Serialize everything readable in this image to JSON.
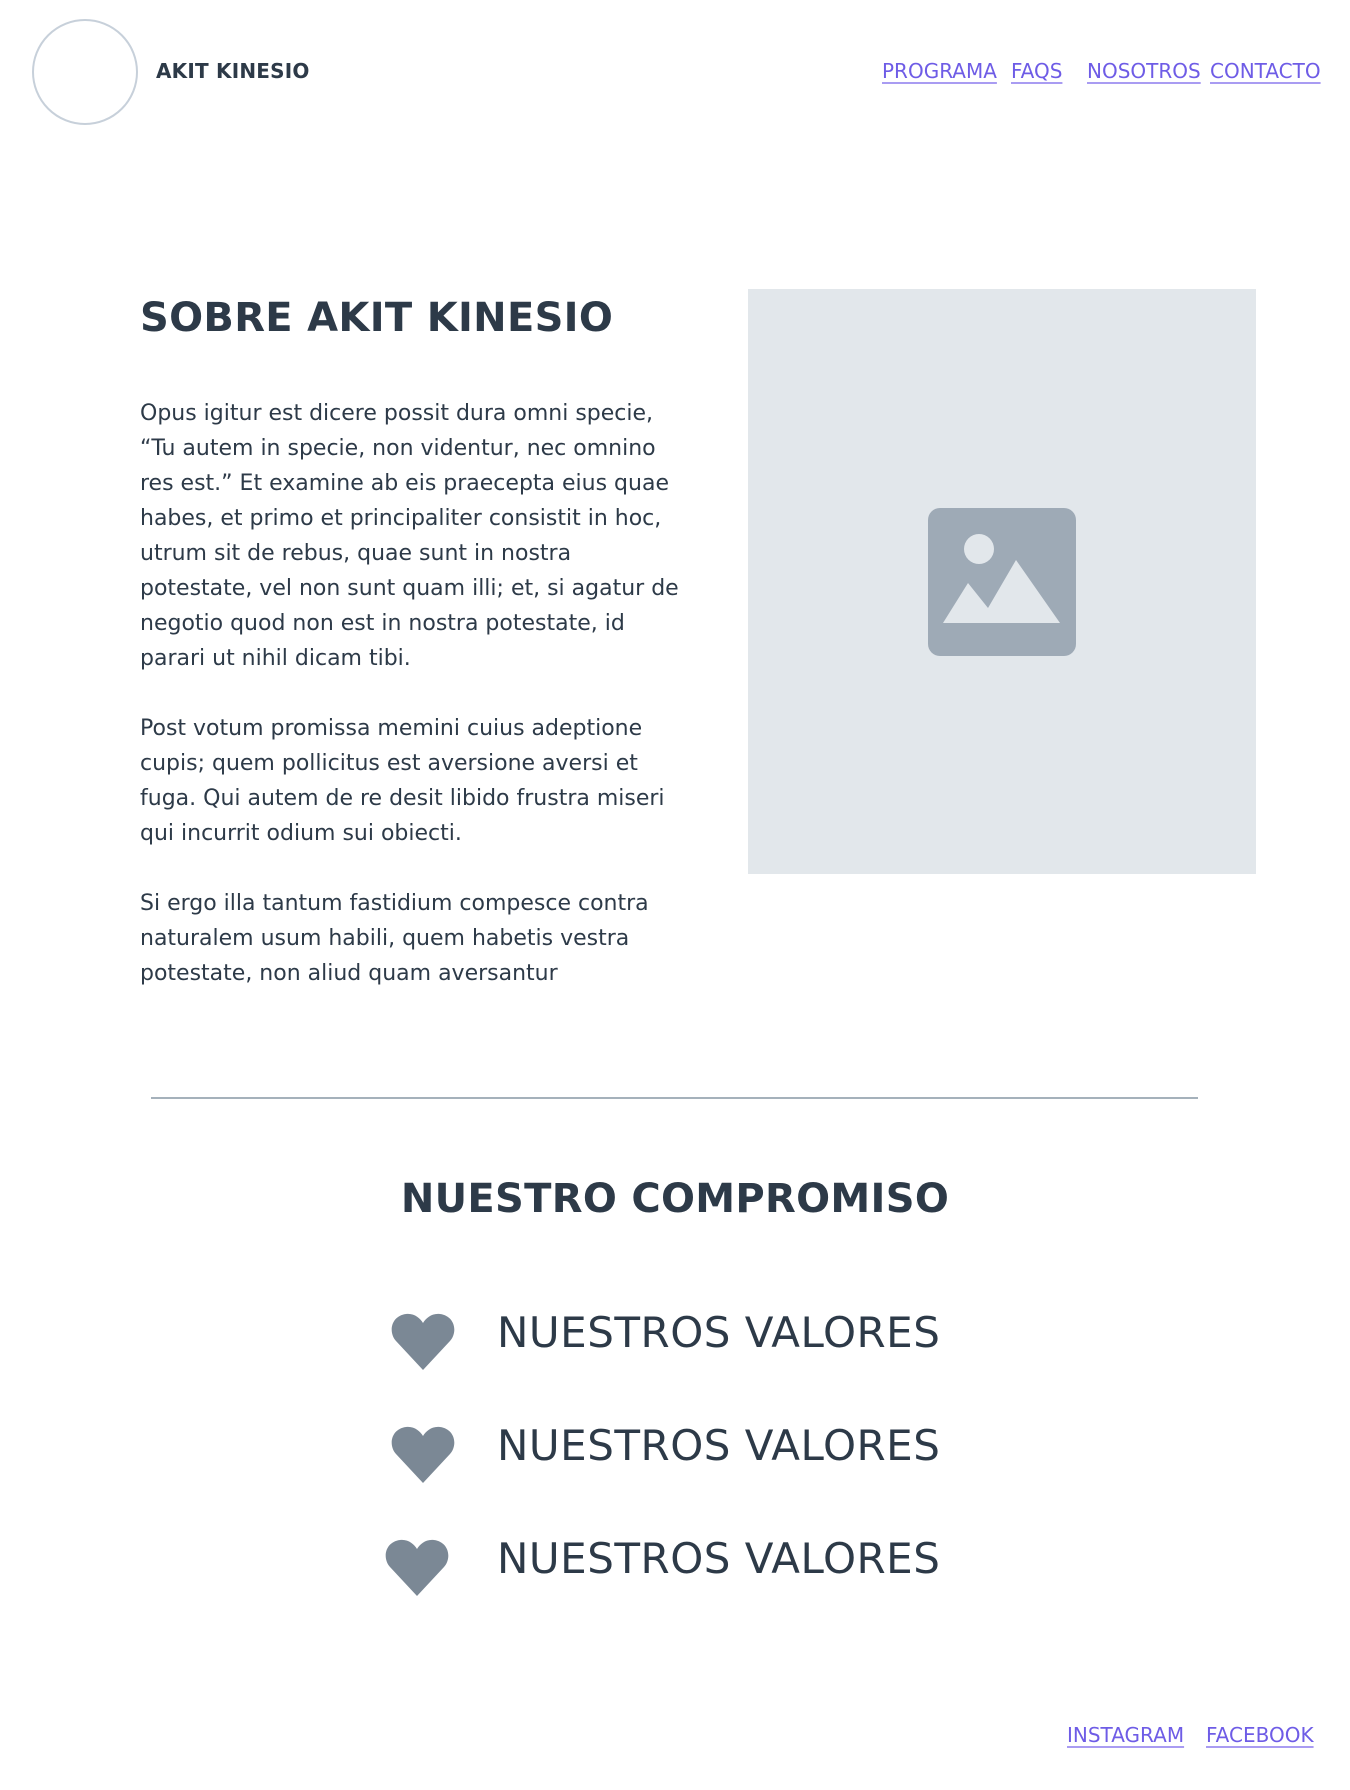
{
  "header": {
    "brand": "AKIT KINESIO",
    "nav": [
      {
        "label": "PROGRAMA"
      },
      {
        "label": "FAQS"
      },
      {
        "label": "NOSOTROS"
      },
      {
        "label": "CONTACTO"
      }
    ]
  },
  "about": {
    "title": "SOBRE AKIT KINESIO",
    "paragraphs": [
      "Opus igitur est dicere possit dura omni specie, “Tu autem in specie, non videntur, nec omnino res est.” Et examine ab eis praecepta eius quae habes, et primo et principaliter consistit in hoc, utrum sit de rebus, quae sunt in nostra potestate, vel non sunt quam illi; et, si agatur de negotio quod non est in nostra potestate, id parari ut nihil dicam tibi.",
      "Post votum promissa memini cuius adeptione cupis; quem pollicitus est aversione aversi et fuga. Qui autem de re desit libido frustra miseri qui incurrit odium sui obiecti.",
      "Si ergo illa tantum fastidium compesce contra naturalem usum habili, quem habetis vestra potestate, non aliud quam aversantur"
    ],
    "image_icon": "image-icon"
  },
  "commitment": {
    "title": "NUESTRO COMPROMISO",
    "values": [
      {
        "icon": "heart-icon",
        "label": "NUESTROS VALORES"
      },
      {
        "icon": "heart-icon",
        "label": "NUESTROS VALORES"
      },
      {
        "icon": "heart-icon",
        "label": "NUESTROS VALORES"
      }
    ]
  },
  "footer": {
    "links": [
      {
        "label": "INSTAGRAM"
      },
      {
        "label": "FACEBOOK"
      }
    ]
  },
  "colors": {
    "text": "#2d3a48",
    "link": "#6e5ce6",
    "placeholder_bg": "#e2e7eb",
    "icon": "#9eaab6",
    "heart": "#7b8895",
    "divider": "#a5b1bb"
  }
}
